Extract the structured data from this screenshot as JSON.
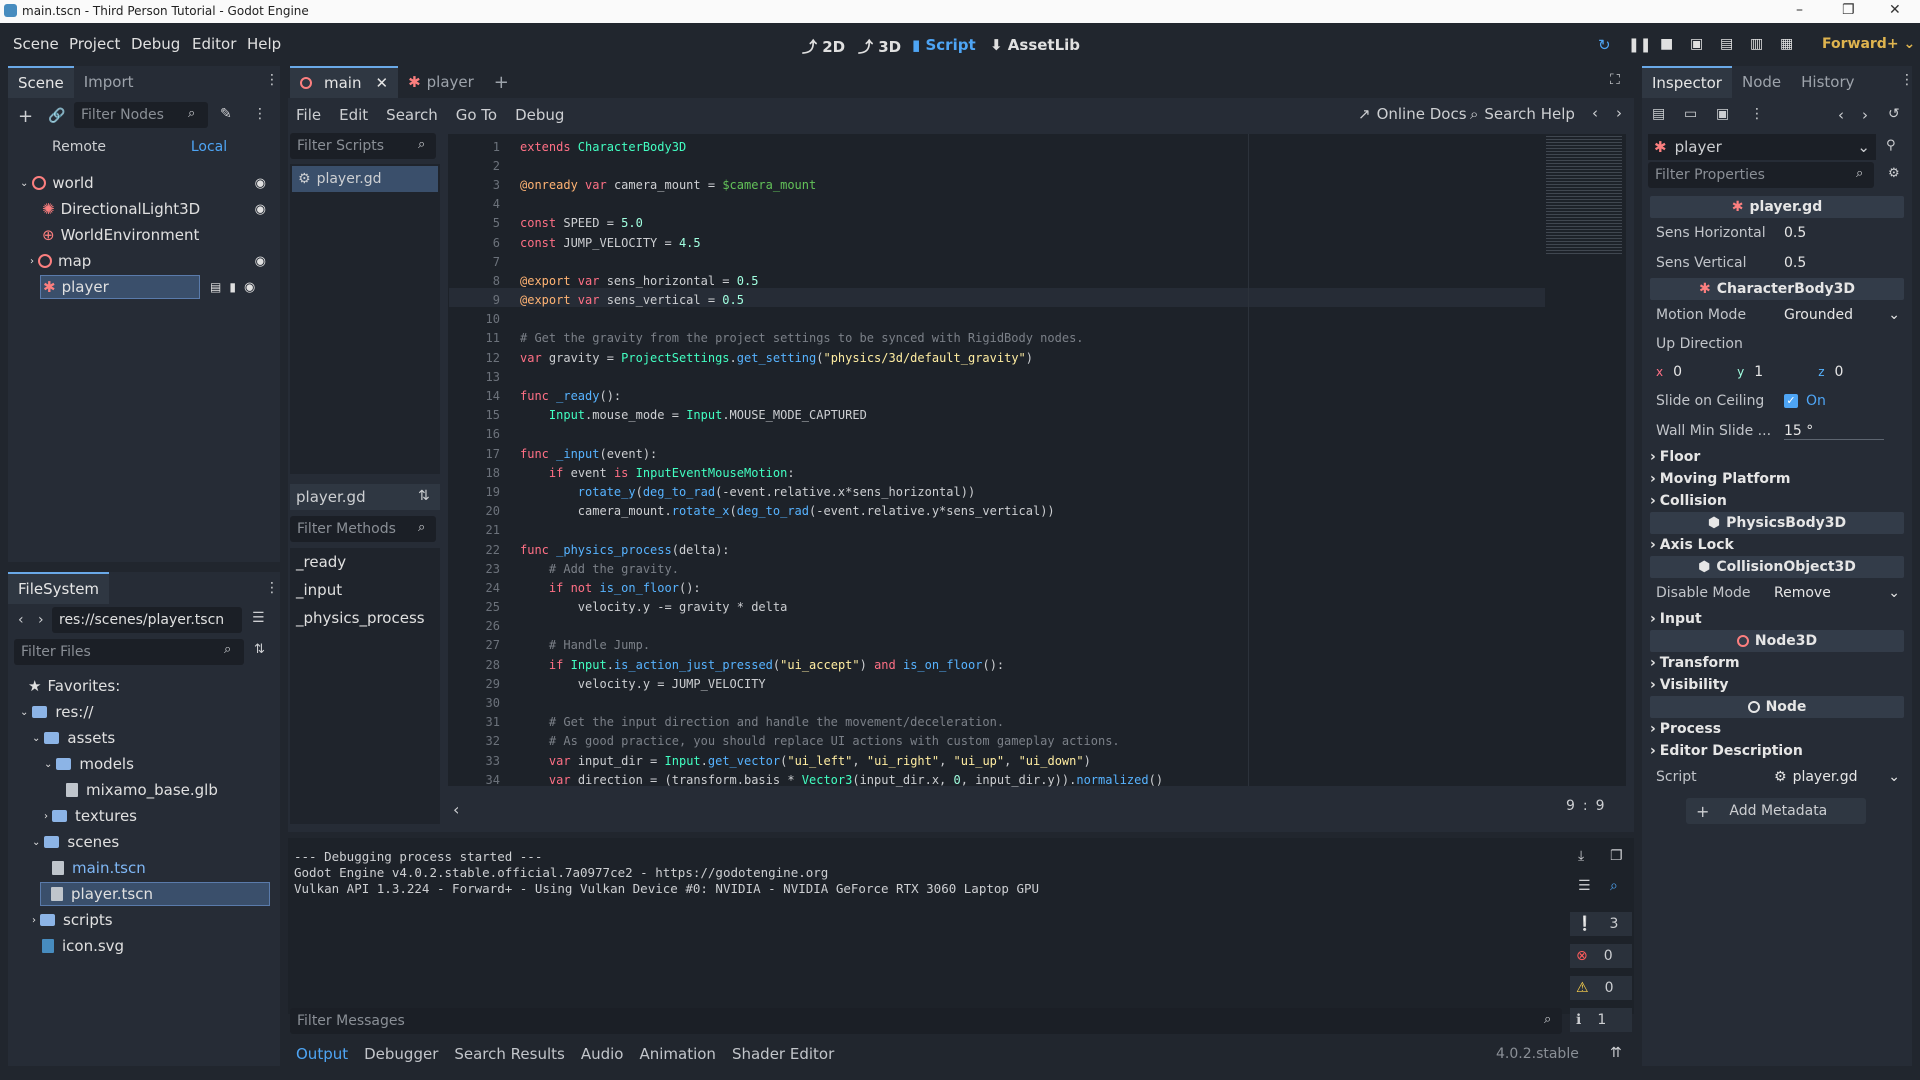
{
  "window": {
    "title": "main.tscn - Third Person Tutorial - Godot Engine",
    "minimize": "–",
    "maximize": "❐",
    "close": "✕"
  },
  "menu": [
    "Scene",
    "Project",
    "Debug",
    "Editor",
    "Help"
  ],
  "workspaces": [
    {
      "icon": "2d-icon",
      "label": "2D"
    },
    {
      "icon": "3d-icon",
      "label": "3D"
    },
    {
      "icon": "script-icon",
      "label": "Script"
    },
    {
      "icon": "assetlib-icon",
      "label": "AssetLib"
    }
  ],
  "renderer": "Forward+",
  "scene_dock": {
    "tabs": [
      "Scene",
      "Import"
    ],
    "filter_placeholder": "Filter Nodes",
    "remote": "Remote",
    "local": "Local",
    "nodes": [
      {
        "label": "world",
        "depth": 0
      },
      {
        "label": "DirectionalLight3D",
        "depth": 1
      },
      {
        "label": "WorldEnvironment",
        "depth": 1
      },
      {
        "label": "map",
        "depth": 1
      },
      {
        "label": "player",
        "depth": 1,
        "selected": true
      }
    ]
  },
  "filesystem": {
    "tab": "FileSystem",
    "path": "res://scenes/player.tscn",
    "filter_placeholder": "Filter Files",
    "items": [
      {
        "label": "Favorites:",
        "depth": 0,
        "kind": "fav"
      },
      {
        "label": "res://",
        "depth": 0,
        "kind": "folder"
      },
      {
        "label": "assets",
        "depth": 1,
        "kind": "folder"
      },
      {
        "label": "models",
        "depth": 2,
        "kind": "folder"
      },
      {
        "label": "mixamo_base.glb",
        "depth": 3,
        "kind": "file"
      },
      {
        "label": "textures",
        "depth": 2,
        "kind": "folder"
      },
      {
        "label": "scenes",
        "depth": 1,
        "kind": "folder"
      },
      {
        "label": "main.tscn",
        "depth": 2,
        "kind": "scene"
      },
      {
        "label": "player.tscn",
        "depth": 2,
        "kind": "scene",
        "selected": true
      },
      {
        "label": "scripts",
        "depth": 1,
        "kind": "folder"
      },
      {
        "label": "icon.svg",
        "depth": 1,
        "kind": "file"
      }
    ]
  },
  "scene_tabs": [
    "main",
    "player"
  ],
  "script_menu": [
    "File",
    "Edit",
    "Search",
    "Go To",
    "Debug"
  ],
  "script_toolbar": {
    "online_docs": "Online Docs",
    "search_help": "Search Help"
  },
  "scripts_list": {
    "filter_placeholder": "Filter Scripts",
    "items": [
      "player.gd"
    ],
    "current": "player.gd",
    "methods_placeholder": "Filter Methods",
    "methods": [
      "_ready",
      "_input",
      "_physics_process"
    ]
  },
  "code": [
    {
      "n": "1",
      "t": [
        [
          "kw",
          "extends "
        ],
        [
          "ty",
          "CharacterBody3D"
        ]
      ]
    },
    {
      "n": "2",
      "t": []
    },
    {
      "n": "3",
      "t": [
        [
          "an",
          "@onready "
        ],
        [
          "kw",
          "var "
        ],
        [
          "tx",
          "camera_mount = "
        ],
        [
          "nd",
          "$camera_mount"
        ]
      ]
    },
    {
      "n": "4",
      "t": []
    },
    {
      "n": "5",
      "t": [
        [
          "kw",
          "const "
        ],
        [
          "tx",
          "SPEED = "
        ],
        [
          "nm",
          "5.0"
        ]
      ]
    },
    {
      "n": "6",
      "t": [
        [
          "kw",
          "const "
        ],
        [
          "tx",
          "JUMP_VELOCITY = "
        ],
        [
          "nm",
          "4.5"
        ]
      ]
    },
    {
      "n": "7",
      "t": []
    },
    {
      "n": "8",
      "t": [
        [
          "an",
          "@export "
        ],
        [
          "kw",
          "var "
        ],
        [
          "tx",
          "sens_horizontal = "
        ],
        [
          "nm",
          "0.5"
        ]
      ]
    },
    {
      "n": "9",
      "t": [
        [
          "an",
          "@export "
        ],
        [
          "kw",
          "var "
        ],
        [
          "tx",
          "sens_vertical = "
        ],
        [
          "nm",
          "0.5"
        ]
      ]
    },
    {
      "n": "10",
      "t": []
    },
    {
      "n": "11",
      "t": [
        [
          "cm",
          "# Get the gravity from the project settings to be synced with RigidBody nodes."
        ]
      ]
    },
    {
      "n": "12",
      "t": [
        [
          "kw",
          "var "
        ],
        [
          "tx",
          "gravity = "
        ],
        [
          "ty",
          "ProjectSettings"
        ],
        [
          "tx",
          "."
        ],
        [
          "fn",
          "get_setting"
        ],
        [
          "tx",
          "("
        ],
        [
          "st",
          "\"physics/3d/default_gravity\""
        ],
        [
          "tx",
          ")"
        ]
      ]
    },
    {
      "n": "13",
      "t": []
    },
    {
      "n": "14",
      "t": [
        [
          "kw",
          "func "
        ],
        [
          "fn",
          "_ready"
        ],
        [
          "tx",
          "():"
        ]
      ]
    },
    {
      "n": "15",
      "t": [
        [
          "tx",
          "    "
        ],
        [
          "ty",
          "Input"
        ],
        [
          "tx",
          ".mouse_mode = "
        ],
        [
          "ty",
          "Input"
        ],
        [
          "tx",
          ".MOUSE_MODE_CAPTURED"
        ]
      ]
    },
    {
      "n": "16",
      "t": []
    },
    {
      "n": "17",
      "t": [
        [
          "kw",
          "func "
        ],
        [
          "fn",
          "_input"
        ],
        [
          "tx",
          "(event):"
        ]
      ]
    },
    {
      "n": "18",
      "t": [
        [
          "tx",
          "    "
        ],
        [
          "kw",
          "if "
        ],
        [
          "tx",
          "event "
        ],
        [
          "kw",
          "is "
        ],
        [
          "ty",
          "InputEventMouseMotion"
        ],
        [
          "tx",
          ":"
        ]
      ]
    },
    {
      "n": "19",
      "t": [
        [
          "tx",
          "        "
        ],
        [
          "fn",
          "rotate_y"
        ],
        [
          "tx",
          "("
        ],
        [
          "fn",
          "deg_to_rad"
        ],
        [
          "tx",
          "(-event.relative.x*sens_horizontal))"
        ]
      ]
    },
    {
      "n": "20",
      "t": [
        [
          "tx",
          "        camera_mount."
        ],
        [
          "fn",
          "rotate_x"
        ],
        [
          "tx",
          "("
        ],
        [
          "fn",
          "deg_to_rad"
        ],
        [
          "tx",
          "(-event.relative.y*sens_vertical))"
        ]
      ]
    },
    {
      "n": "21",
      "t": []
    },
    {
      "n": "22",
      "t": [
        [
          "kw",
          "func "
        ],
        [
          "fn",
          "_physics_process"
        ],
        [
          "tx",
          "(delta):"
        ]
      ]
    },
    {
      "n": "23",
      "t": [
        [
          "tx",
          "    "
        ],
        [
          "cm",
          "# Add the gravity."
        ]
      ]
    },
    {
      "n": "24",
      "t": [
        [
          "tx",
          "    "
        ],
        [
          "kw",
          "if not "
        ],
        [
          "fn",
          "is_on_floor"
        ],
        [
          "tx",
          "():"
        ]
      ]
    },
    {
      "n": "25",
      "t": [
        [
          "tx",
          "        velocity.y -= gravity * delta"
        ]
      ]
    },
    {
      "n": "26",
      "t": []
    },
    {
      "n": "27",
      "t": [
        [
          "tx",
          "    "
        ],
        [
          "cm",
          "# Handle Jump."
        ]
      ]
    },
    {
      "n": "28",
      "t": [
        [
          "tx",
          "    "
        ],
        [
          "kw",
          "if "
        ],
        [
          "ty",
          "Input"
        ],
        [
          "tx",
          "."
        ],
        [
          "fn",
          "is_action_just_pressed"
        ],
        [
          "tx",
          "("
        ],
        [
          "st",
          "\"ui_accept\""
        ],
        [
          "tx",
          ") "
        ],
        [
          "kw",
          "and "
        ],
        [
          "fn",
          "is_on_floor"
        ],
        [
          "tx",
          "():"
        ]
      ]
    },
    {
      "n": "29",
      "t": [
        [
          "tx",
          "        velocity.y = JUMP_VELOCITY"
        ]
      ]
    },
    {
      "n": "30",
      "t": []
    },
    {
      "n": "31",
      "t": [
        [
          "tx",
          "    "
        ],
        [
          "cm",
          "# Get the input direction and handle the movement/deceleration."
        ]
      ]
    },
    {
      "n": "32",
      "t": [
        [
          "tx",
          "    "
        ],
        [
          "cm",
          "# As good practice, you should replace UI actions with custom gameplay actions."
        ]
      ]
    },
    {
      "n": "33",
      "t": [
        [
          "tx",
          "    "
        ],
        [
          "kw",
          "var "
        ],
        [
          "tx",
          "input_dir = "
        ],
        [
          "ty",
          "Input"
        ],
        [
          "tx",
          "."
        ],
        [
          "fn",
          "get_vector"
        ],
        [
          "tx",
          "("
        ],
        [
          "st",
          "\"ui_left\""
        ],
        [
          "tx",
          ", "
        ],
        [
          "st",
          "\"ui_right\""
        ],
        [
          "tx",
          ", "
        ],
        [
          "st",
          "\"ui_up\""
        ],
        [
          "tx",
          ", "
        ],
        [
          "st",
          "\"ui_down\""
        ],
        [
          "tx",
          ")"
        ]
      ]
    },
    {
      "n": "34",
      "t": [
        [
          "tx",
          "    "
        ],
        [
          "kw",
          "var "
        ],
        [
          "tx",
          "direction = (transform.basis * "
        ],
        [
          "ty",
          "Vector3"
        ],
        [
          "tx",
          "(input_dir.x, "
        ],
        [
          "nm",
          "0"
        ],
        [
          "tx",
          ", input_dir.y))."
        ],
        [
          "fn",
          "normalized"
        ],
        [
          "tx",
          "()"
        ]
      ]
    }
  ],
  "cursor": {
    "line": "9",
    "sep": ":",
    "col": "9"
  },
  "output": {
    "lines": [
      "--- Debugging process started ---",
      "Godot Engine v4.0.2.stable.official.7a0977ce2 - https://godotengine.org",
      "Vulkan API 1.3.224 - Forward+ - Using Vulkan Device #0: NVIDIA - NVIDIA GeForce RTX 3060 Laptop GPU"
    ],
    "counts": [
      "3",
      "0",
      "0",
      "1"
    ],
    "filter_placeholder": "Filter Messages"
  },
  "bottom_tabs": [
    "Output",
    "Debugger",
    "Search Results",
    "Audio",
    "Animation",
    "Shader Editor"
  ],
  "version": "4.0.2.stable",
  "inspector": {
    "tabs": [
      "Inspector",
      "Node",
      "History"
    ],
    "object": "player",
    "filter_placeholder": "Filter Properties",
    "script_header": "player.gd",
    "sens_horizontal": {
      "label": "Sens Horizontal",
      "value": "0.5"
    },
    "sens_vertical": {
      "label": "Sens Vertical",
      "value": "0.5"
    },
    "character_header": "CharacterBody3D",
    "motion_mode": {
      "label": "Motion Mode",
      "value": "Grounded"
    },
    "up_direction": {
      "label": "Up Direction",
      "x": "0",
      "y": "1",
      "z": "0",
      "xl": "x",
      "yl": "y",
      "zl": "z"
    },
    "slide_on_ceiling": {
      "label": "Slide on Ceiling",
      "value": "On"
    },
    "wall_min_slide": {
      "label": "Wall Min Slide ...",
      "value": "15 °"
    },
    "sections1": [
      "Floor",
      "Moving Platform",
      "Collision"
    ],
    "physics_header": "PhysicsBody3D",
    "axis_lock": "Axis Lock",
    "collision_header": "CollisionObject3D",
    "disable_mode": {
      "label": "Disable Mode",
      "value": "Remove"
    },
    "input": "Input",
    "node3d_header": "Node3D",
    "sections2": [
      "Transform",
      "Visibility"
    ],
    "node_header": "Node",
    "sections3": [
      "Process",
      "Editor Description"
    ],
    "script": {
      "label": "Script",
      "value": "player.gd"
    },
    "add_metadata": "Add Metadata"
  },
  "colors": {
    "accent": "#4ea5f5",
    "node3d": "#fc7f7f",
    "bg": "#21262e"
  }
}
